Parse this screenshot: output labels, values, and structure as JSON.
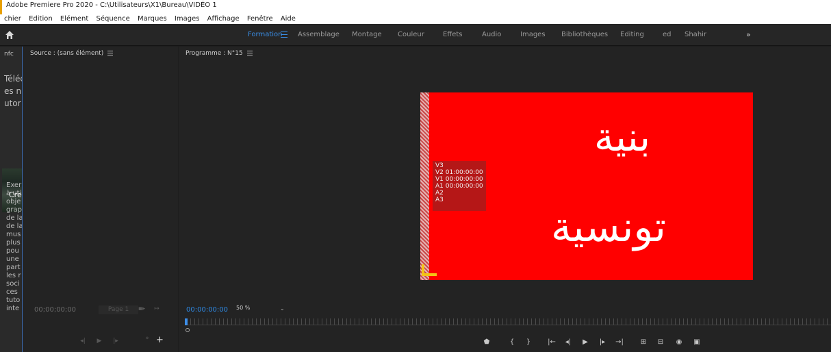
{
  "app": {
    "title": "Adobe Premiere Pro 2020 - C:\\Utilisateurs\\X1\\Bureau\\VIDÉO 1"
  },
  "menu": [
    "chier",
    "Edition",
    "Elément",
    "Séquence",
    "Marques",
    "Images",
    "Affichage",
    "Fenêtre",
    "Aide"
  ],
  "workspaces": {
    "active": "Formation",
    "items": [
      "Assemblage",
      "Montage",
      "Couleur",
      "Effets",
      "Audio",
      "Images",
      "Bibliothèques",
      "Editing",
      "ed",
      "Shahir"
    ],
    "more": "»",
    "accent": "#3a8ee6"
  },
  "left_panel": {
    "tab": "nfc",
    "lines_big": [
      "Téléc",
      "es n",
      "utor"
    ],
    "thumb_label": "Cre",
    "lines_small": [
      "Exer",
      "à uti",
      "obje",
      "grap",
      "de la",
      "de la",
      "mus",
      "plus",
      "pou",
      "une",
      "part",
      "les r",
      "soci",
      "ces",
      "tuto",
      "inte"
    ]
  },
  "source_panel": {
    "title": "Source : (sans élément)",
    "timecode": "00;00;00;00",
    "page": "Page 1"
  },
  "program_panel": {
    "title": "Programme : N°15",
    "timecode": "00:00:00:00",
    "zoom": "50 %",
    "frame_color": "#ff0000",
    "overlay": [
      "V3",
      "V2 01:00:00:00",
      "V1 00:00:00:00",
      "A1 00:00:00:00",
      "A2",
      "A3"
    ],
    "arabic_line1": "بنية",
    "arabic_line2": "تونسية"
  },
  "transport": {
    "marker": "⬟",
    "mark_in": "{",
    "mark_out": "}",
    "go_in": "|←",
    "step_back": "◂|",
    "play": "▶",
    "step_fwd": "|▸",
    "go_out": "→|",
    "insert": "⊞",
    "overwrite": "⊟",
    "export_frame": "◉",
    "compare": "▣"
  }
}
